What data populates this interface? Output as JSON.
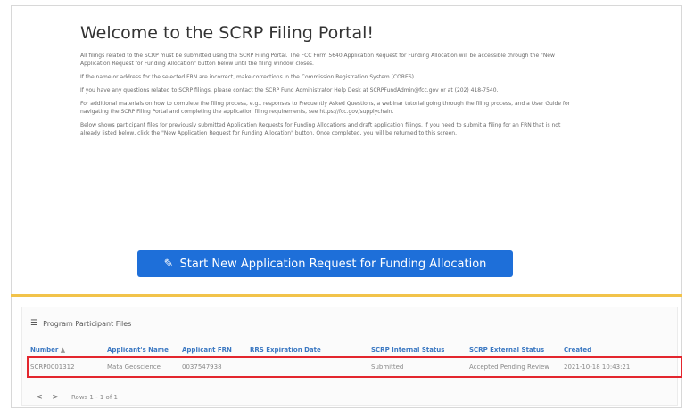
{
  "welcome": {
    "title": "Welcome to the SCRP Filing Portal!",
    "paragraphs": [
      "All filings related to the SCRP must be submitted using the SCRP Filing Portal. The FCC Form 5640 Application Request for Funding Allocation will be accessible through the \"New Application Request for Funding Allocation\" button below until the filing window closes.",
      "If the name or address for the selected FRN are incorrect, make corrections in the Commission Registration System (CORES).",
      "If you have any questions related to SCRP filings, please contact the SCRP Fund Administrator Help Desk at SCRPFundAdmin@fcc.gov or at (202) 418-7540.",
      "For additional materials on how to complete the filing process, e.g., responses to Frequently Asked Questions, a webinar tutorial going through the filing process, and a User Guide for navigating the SCRP Filing Portal and completing the application filing requirements, see https://fcc.gov/supplychain.",
      "Below shows participant files for previously submitted Application Requests for Funding Allocations and draft application filings. If you need to submit a filing for an FRN that is not already listed below, click the \"New Application Request for Funding Allocation\" button. Once completed, you will be returned to this screen."
    ]
  },
  "start_button": {
    "label": "Start New Application Request for Funding Allocation",
    "icon": "pencil-icon"
  },
  "files_panel": {
    "title": "Program Participant Files",
    "icon": "list-icon",
    "columns": [
      "Number",
      "Applicant's Name",
      "Applicant FRN",
      "RRS Expiration Date",
      "SCRP Internal Status",
      "SCRP External Status",
      "Created"
    ],
    "sort_indicator": "▲",
    "rows": [
      [
        "SCRP0001312",
        "Mata Geoscience",
        "0037547938",
        "",
        "Submitted",
        "Accepted Pending Review",
        "2021-10-18 10:43:21"
      ]
    ],
    "pagination": {
      "prev": "<",
      "next": ">",
      "summary": "Rows 1 - 1 of 1"
    }
  },
  "colors": {
    "accent": "#1e6fd9",
    "highlight": "#e3262e",
    "band": "#f2c34a",
    "link": "#3b78c2"
  }
}
